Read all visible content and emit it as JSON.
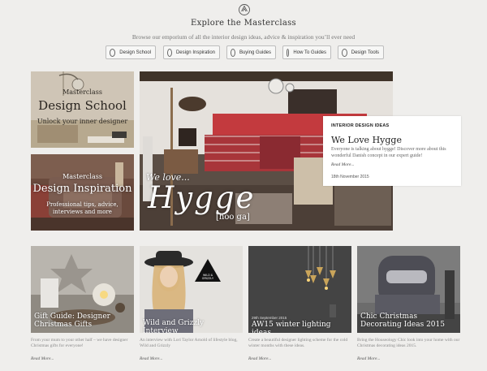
{
  "header": {
    "title": "Explore the Masterclass",
    "tagline": "Browse our emporium of all the interior design ideas, advice & inspiration you’ll ever need",
    "logo_icon": "compass-logo-icon"
  },
  "nav": [
    {
      "label": "Design School",
      "icon": "graduation-icon"
    },
    {
      "label": "Design Inspiration",
      "icon": "lightbulb-icon"
    },
    {
      "label": "Buying Guides",
      "icon": "tag-icon"
    },
    {
      "label": "How To Guides",
      "icon": "tools-icon"
    },
    {
      "label": "Design Tools",
      "icon": "palette-icon"
    }
  ],
  "tiles": {
    "school": {
      "kicker": "Masterclass",
      "title": "Design School",
      "subtitle": "Unlock your inner designer"
    },
    "inspiration": {
      "kicker": "Masterclass",
      "title": "Design Inspiration",
      "subtitle": "Professional tips, advice, interviews and more"
    },
    "hero": {
      "overlay_small": "We love...",
      "overlay_big": "Hygge",
      "overlay_phon": "[hoo ga]"
    }
  },
  "feature_card": {
    "label": "INTERIOR DESIGN IDEAS",
    "title": "We Love Hygge",
    "description": "Everyone is talking about hygge! Discover more about this wonderful Danish concept in our expert guide!",
    "read_more": "Read More...",
    "date": "18th November 2015"
  },
  "posts": [
    {
      "date": "",
      "title": "Gift Guide: Designer Christmas Gifts",
      "description": "From your mum to your other half – we have designer Christmas gifts for everyone!",
      "read_more": "Read More..."
    },
    {
      "date": "",
      "title": "Wild and Grizzly Interview",
      "description": "An interview with Lori Taylor Arnold of lifestyle blog, Wild and Grizzly",
      "read_more": "Read More..."
    },
    {
      "date": "29th September 2015",
      "title": "AW15 winter lighting ideas",
      "description": "Create a beautiful designer lighting scheme for the cold winter months with these ideas.",
      "read_more": "Read More..."
    },
    {
      "date": "",
      "title": "Chic Christmas Decorating Ideas 2015",
      "description": "Bring the Houseology Chic look into your home with our Christmas decorating ideas 2015.",
      "read_more": "Read More..."
    }
  ],
  "wild_grizzly_badge": "WILD & GRIZZLY"
}
